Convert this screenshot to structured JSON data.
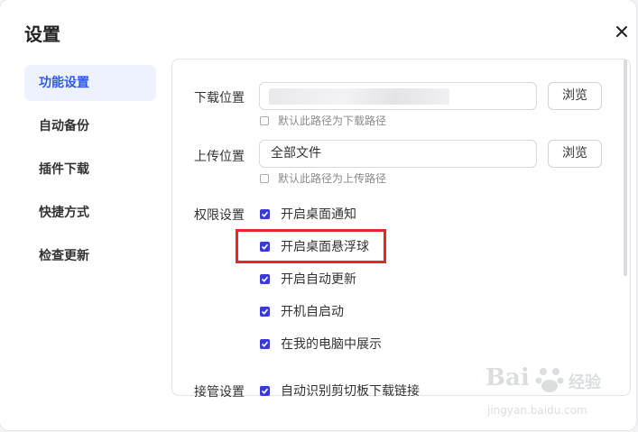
{
  "dialog": {
    "title": "设置"
  },
  "sidebar": {
    "items": [
      {
        "label": "功能设置",
        "active": true
      },
      {
        "label": "自动备份"
      },
      {
        "label": "插件下载"
      },
      {
        "label": "快捷方式"
      },
      {
        "label": "检查更新"
      }
    ]
  },
  "download": {
    "label": "下载位置",
    "value": "",
    "browse": "浏览",
    "default_hint": "默认此路径为下载路径",
    "default_checked": false
  },
  "upload": {
    "label": "上传位置",
    "value": "全部文件",
    "browse": "浏览",
    "default_hint": "默认此路径为上传路径",
    "default_checked": false
  },
  "permissions": {
    "label": "权限设置",
    "options": [
      {
        "label": "开启桌面通知",
        "checked": true
      },
      {
        "label": "开启桌面悬浮球",
        "checked": true
      },
      {
        "label": "开启自动更新",
        "checked": true
      },
      {
        "label": "开机自启动",
        "checked": true
      },
      {
        "label": "在我的电脑中展示",
        "checked": true
      }
    ]
  },
  "takeover": {
    "label": "接管设置",
    "option": {
      "label": "自动识别剪切板下载链接",
      "checked": true
    }
  },
  "watermark": {
    "brand": "Bai",
    "brand2": "经验",
    "url": "jingyan.baidu.com"
  },
  "colors": {
    "accent": "#2f5bea",
    "checkbox": "#3a3ad6",
    "highlight": "#e8262a"
  },
  "icons": {
    "close": "close-icon",
    "check": "check-icon"
  }
}
